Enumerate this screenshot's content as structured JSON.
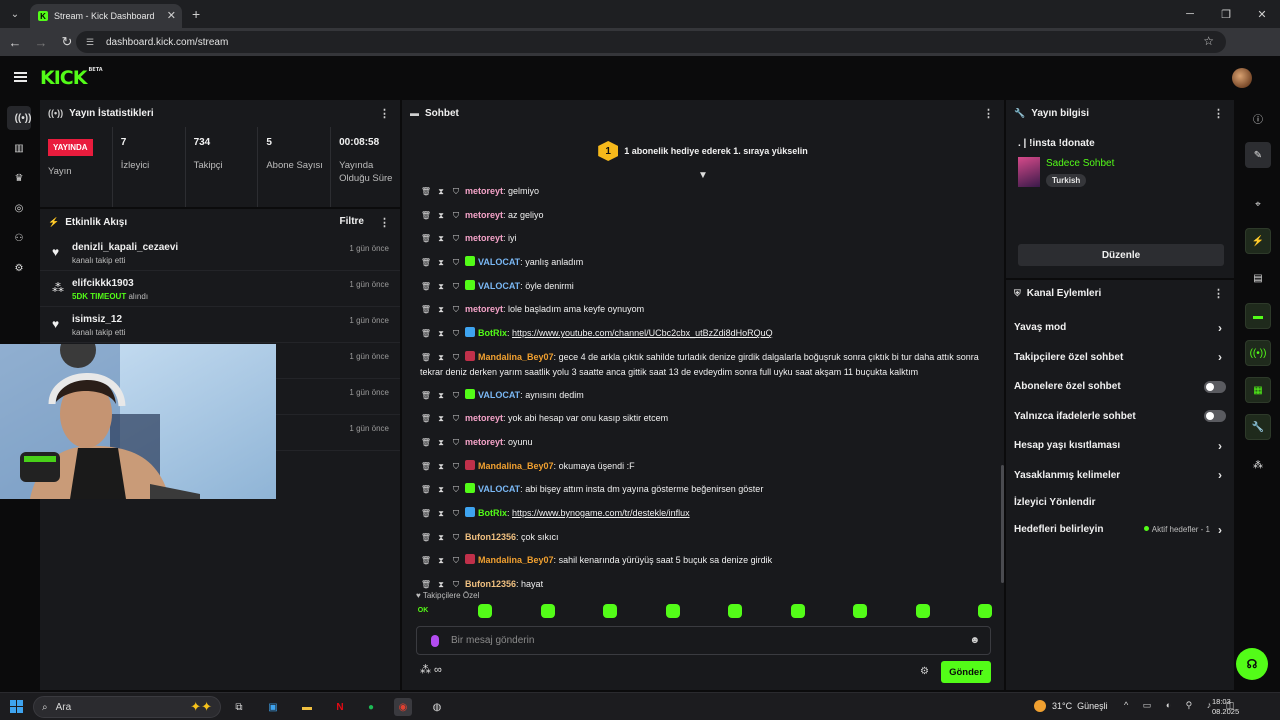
{
  "browser": {
    "tab_title": "Stream - Kick Dashboard",
    "url": "dashboard.kick.com/stream"
  },
  "header": {
    "logo": "KICK",
    "beta": "BETA"
  },
  "stats": {
    "title": "Yayın İstatistikleri",
    "live_badge": "YAYINDA",
    "cells": [
      {
        "value": "",
        "label": "Yayın"
      },
      {
        "value": "7",
        "label": "İzleyici"
      },
      {
        "value": "734",
        "label": "Takipçi"
      },
      {
        "value": "5",
        "label": "Abone Sayısı"
      },
      {
        "value": "00:08:58",
        "label": "Yayında Olduğu Süre"
      }
    ]
  },
  "activity": {
    "title": "Etkinlik Akışı",
    "filter": "Filtre",
    "items": [
      {
        "icon": "heart-icon",
        "name": "denizli_kapali_cezaevi",
        "sub": "kanalı takip etti",
        "highlight": "",
        "time": "1 gün önce"
      },
      {
        "icon": "kick-dots-icon",
        "name": "elifcikkk1903",
        "sub": "alındı",
        "highlight": "5DK TIMEOUT",
        "time": "1 gün önce"
      },
      {
        "icon": "heart-icon",
        "name": "isimsiz_12",
        "sub": "kanalı takip etti",
        "highlight": "",
        "time": "1 gün önce"
      },
      {
        "icon": "",
        "name": "",
        "sub": "",
        "highlight": "",
        "time": "1 gün önce"
      },
      {
        "icon": "",
        "name": "",
        "sub": "",
        "highlight": "",
        "time": "1 gün önce"
      },
      {
        "icon": "",
        "name": "",
        "sub": "",
        "highlight": "",
        "time": "1 gün önce"
      }
    ]
  },
  "chat": {
    "title": "Sohbet",
    "pinned_rank": "1",
    "pinned_text": "1 abonelik hediye ederek 1. sıraya yükselin",
    "messages": [
      {
        "user": "metoreyt",
        "color": "#f4a3c8",
        "badge": "",
        "text": "gelmiyo",
        "link": ""
      },
      {
        "user": "metoreyt",
        "color": "#f4a3c8",
        "badge": "",
        "text": "az geliyo",
        "link": ""
      },
      {
        "user": "metoreyt",
        "color": "#f4a3c8",
        "badge": "",
        "text": "iyi",
        "link": ""
      },
      {
        "user": "VALOCAT",
        "color": "#7ab8f5",
        "badge": "#53fc18",
        "text": "yanlış anladım",
        "link": ""
      },
      {
        "user": "VALOCAT",
        "color": "#7ab8f5",
        "badge": "#53fc18",
        "text": "öyle denirmi",
        "link": ""
      },
      {
        "user": "metoreyt",
        "color": "#f4a3c8",
        "badge": "",
        "text": "lole başladım ama keyfe oynuyom",
        "link": ""
      },
      {
        "user": "BotRix",
        "color": "#53fc18",
        "badge": "#3ea4f0",
        "text": "",
        "link": "https://www.youtube.com/channel/UCbc2cbx_utBzZdi8dHoRQuQ"
      },
      {
        "user": "Mandalina_Bey07",
        "color": "#f0a030",
        "badge": "#c0304a",
        "text": "gece 4 de arkla çıktık sahilde turladık denize girdik dalgalarla boğuşruk sonra çıktık bi tur daha attık sonra tekrar deniz derken yarım saatlik yolu 3 saatte anca gittik saat 13 de evdeydim sonra full uyku saat akşam 11 buçukta kalktım",
        "link": ""
      },
      {
        "user": "VALOCAT",
        "color": "#7ab8f5",
        "badge": "#53fc18",
        "text": "aynısını dedim",
        "link": ""
      },
      {
        "user": "metoreyt",
        "color": "#f4a3c8",
        "badge": "",
        "text": "yok abi hesap var onu kasıp siktir etcem",
        "link": ""
      },
      {
        "user": "metoreyt",
        "color": "#f4a3c8",
        "badge": "",
        "text": "oyunu",
        "link": ""
      },
      {
        "user": "Mandalina_Bey07",
        "color": "#f0a030",
        "badge": "#c0304a",
        "text": "okumaya üşendi :F",
        "link": ""
      },
      {
        "user": "VALOCAT",
        "color": "#7ab8f5",
        "badge": "#53fc18",
        "text": "abi bişey attım insta dm yayına gösterme beğenirsen göster",
        "link": ""
      },
      {
        "user": "BotRix",
        "color": "#53fc18",
        "badge": "#3ea4f0",
        "text": "",
        "link": "https://www.bynogame.com/tr/destekle/influx"
      },
      {
        "user": "Bufon12356",
        "color": "#f0c080",
        "badge": "",
        "text": "çok sıkıcı",
        "link": ""
      },
      {
        "user": "Mandalina_Bey07",
        "color": "#f0a030",
        "badge": "#c0304a",
        "text": "sahil kenarında yürüyüş saat 5 buçuk sa denize girdik",
        "link": ""
      },
      {
        "user": "Bufon12356",
        "color": "#f0c080",
        "badge": "",
        "text": "hayat",
        "link": ""
      }
    ],
    "followers_only": "Takipçilere Özel",
    "placeholder": "Bir mesaj gönderin",
    "send": "Gönder"
  },
  "stream_info": {
    "title": "Yayın bilgisi",
    "stream_title": ". | !insta !donate",
    "category": "Sadece Sohbet",
    "language": "Turkish",
    "edit": "Düzenle"
  },
  "channel_actions": {
    "title": "Kanal Eylemleri",
    "items": [
      {
        "label": "Yavaş mod",
        "control": "chevron"
      },
      {
        "label": "Takipçilere özel sohbet",
        "control": "chevron"
      },
      {
        "label": "Abonelere özel sohbet",
        "control": "toggle"
      },
      {
        "label": "Yalnızca ifadelerle sohbet",
        "control": "toggle"
      },
      {
        "label": "Hesap yaşı kısıtlaması",
        "control": "chevron"
      },
      {
        "label": "Yasaklanmış kelimeler",
        "control": "chevron"
      },
      {
        "label": "İzleyici Yönlendir",
        "control": "none"
      },
      {
        "label": "Hedefleri belirleyin",
        "control": "goal"
      }
    ],
    "goal_text": "Aktif hedefler - 1"
  },
  "taskbar": {
    "search": "Ara",
    "temp": "31°C",
    "weather": "Güneşli",
    "time": "18:03",
    "date": "08.2025"
  },
  "colors": {
    "accent": "#53fc18",
    "live": "#e91c3d",
    "panel": "#18191c",
    "bg": "#0b0b0c"
  }
}
